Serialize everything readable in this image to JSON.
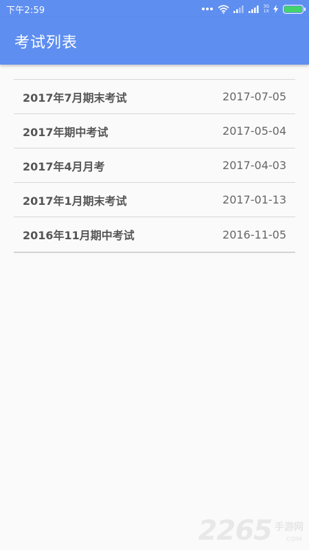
{
  "status_bar": {
    "time": "下午2:59",
    "network_top": "3G",
    "network_bottom": "1X",
    "battery_level": 1.0,
    "battery_color": "#44d36b"
  },
  "app_bar": {
    "title": "考试列表",
    "color": "#5e8ef0"
  },
  "exams": [
    {
      "name": "2017年7月期末考试",
      "date": "2017-07-05"
    },
    {
      "name": "2017年期中考试",
      "date": "2017-05-04"
    },
    {
      "name": "2017年4月月考",
      "date": "2017-04-03"
    },
    {
      "name": "2017年1月期末考试",
      "date": "2017-01-13"
    },
    {
      "name": "2016年11月期中考试",
      "date": "2016-11-05"
    }
  ],
  "watermark": {
    "number": "2265",
    "text": "手游网",
    "suffix": "COM"
  }
}
